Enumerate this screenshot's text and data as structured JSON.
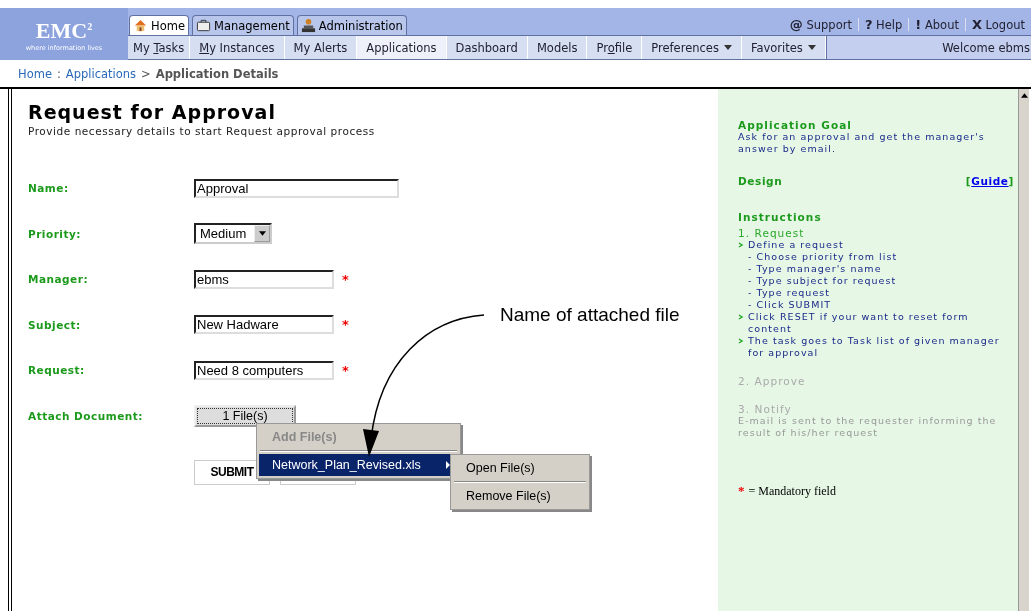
{
  "header": {
    "logo": {
      "brand": "EMC",
      "sup": "2",
      "tagline": "where information lives"
    },
    "top_tabs": [
      {
        "label": "Home",
        "selected": true
      },
      {
        "label": "Management",
        "selected": false
      },
      {
        "label": "Administration",
        "selected": false
      }
    ],
    "utility_links": [
      {
        "glyph": "@",
        "label": "Support"
      },
      {
        "glyph": "?",
        "label": "Help"
      },
      {
        "glyph": "!",
        "label": "About"
      },
      {
        "glyph": "X",
        "label": "Logout"
      }
    ],
    "nav_items": [
      {
        "before": "My ",
        "key": "T",
        "after": "asks",
        "selected": false,
        "dropdown": false
      },
      {
        "key": "M",
        "after": "y Instances",
        "selected": false,
        "dropdown": false
      },
      {
        "before": "My Alerts",
        "selected": false,
        "dropdown": false
      },
      {
        "before": "Applications",
        "selected": true,
        "dropdown": false
      },
      {
        "before": "Dashboard",
        "selected": false,
        "dropdown": false
      },
      {
        "before": "Models",
        "selected": false,
        "dropdown": false
      },
      {
        "before": "Pr",
        "key": "o",
        "after": "file",
        "selected": false,
        "dropdown": false
      },
      {
        "before": "Preferences",
        "selected": false,
        "dropdown": true
      },
      {
        "before": "Favorites",
        "selected": false,
        "dropdown": true
      }
    ],
    "welcome": "Welcome ebms"
  },
  "breadcrumb": [
    {
      "kind": "link",
      "text": "Home"
    },
    {
      "kind": "sep",
      "text": ":"
    },
    {
      "kind": "link",
      "text": "Applications"
    },
    {
      "kind": "sep",
      "text": ">"
    },
    {
      "kind": "current",
      "text": "Application Details"
    }
  ],
  "form": {
    "title": "Request for Approval",
    "subtitle": "Provide necessary details to start Request approval process",
    "fields": [
      {
        "label": "Name:",
        "kind": "text",
        "wide": true,
        "value": "Approval",
        "required": false
      },
      {
        "label": "Priority:",
        "kind": "select",
        "value": "Medium",
        "required": false
      },
      {
        "label": "Manager:",
        "kind": "text",
        "wide": false,
        "value": "ebms",
        "required": true
      },
      {
        "label": "Subject:",
        "kind": "text",
        "wide": false,
        "value": "New Hadware",
        "required": true
      },
      {
        "label": "Request:",
        "kind": "text",
        "wide": false,
        "value": "Need 8 computers",
        "required": true
      },
      {
        "label": "Attach Document:",
        "kind": "button",
        "value": "1 File(s)",
        "required": false
      }
    ],
    "required_mark": "*",
    "submit": "SUBMIT"
  },
  "context_menu": {
    "items": [
      {
        "label": "Add File(s)",
        "disabled": true,
        "selected": false,
        "submenu": false
      },
      {
        "label": "Network_Plan_Revised.xls",
        "disabled": false,
        "selected": true,
        "submenu": true
      }
    ],
    "submenu": [
      "Open File(s)",
      "Remove File(s)"
    ]
  },
  "annotation": {
    "text": "Name of attached file"
  },
  "sidebar": {
    "goal_title": "Application Goal",
    "goal_text": "Ask for an approval and get the manager's answer by email.",
    "design_title": "Design",
    "guide": {
      "open": "[",
      "link": "Guide",
      "close": "]"
    },
    "instructions_title": "Instructions",
    "steps": [
      {
        "title": "1. Request",
        "active": true,
        "items": [
          {
            "text": "Define a request",
            "children": [
              {
                "text": "- Choose priority from list"
              },
              {
                "text": "- Type manager's name"
              },
              {
                "text": "- Type subject for request"
              },
              {
                "text": "- Type request"
              },
              {
                "text": "- Click SUBMIT"
              }
            ]
          },
          {
            "text": "Click RESET if your want to reset form content"
          },
          {
            "text": "The task goes to Task list of given manager for approval"
          }
        ]
      },
      {
        "title": "2. Approve",
        "active": false
      },
      {
        "title": "3. Notify",
        "active": false,
        "note": "E-mail is sent to the requester informing the result of his/her request"
      }
    ],
    "mandatory": {
      "mark": "*",
      "text": "= Mandatory field"
    }
  }
}
